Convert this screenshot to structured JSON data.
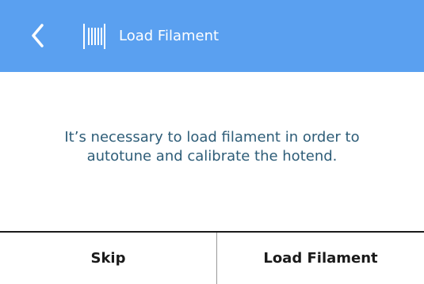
{
  "header": {
    "title": "Load Filament",
    "background_color": "#5aa0f0",
    "back_icon": "chevron-left-icon",
    "title_icon": "filament-spool-icon"
  },
  "main": {
    "message": "It’s necessary to load filament in order to autotune and calibrate the hotend.",
    "message_color": "#2e5d78"
  },
  "footer": {
    "skip_label": "Skip",
    "load_label": "Load Filament"
  }
}
